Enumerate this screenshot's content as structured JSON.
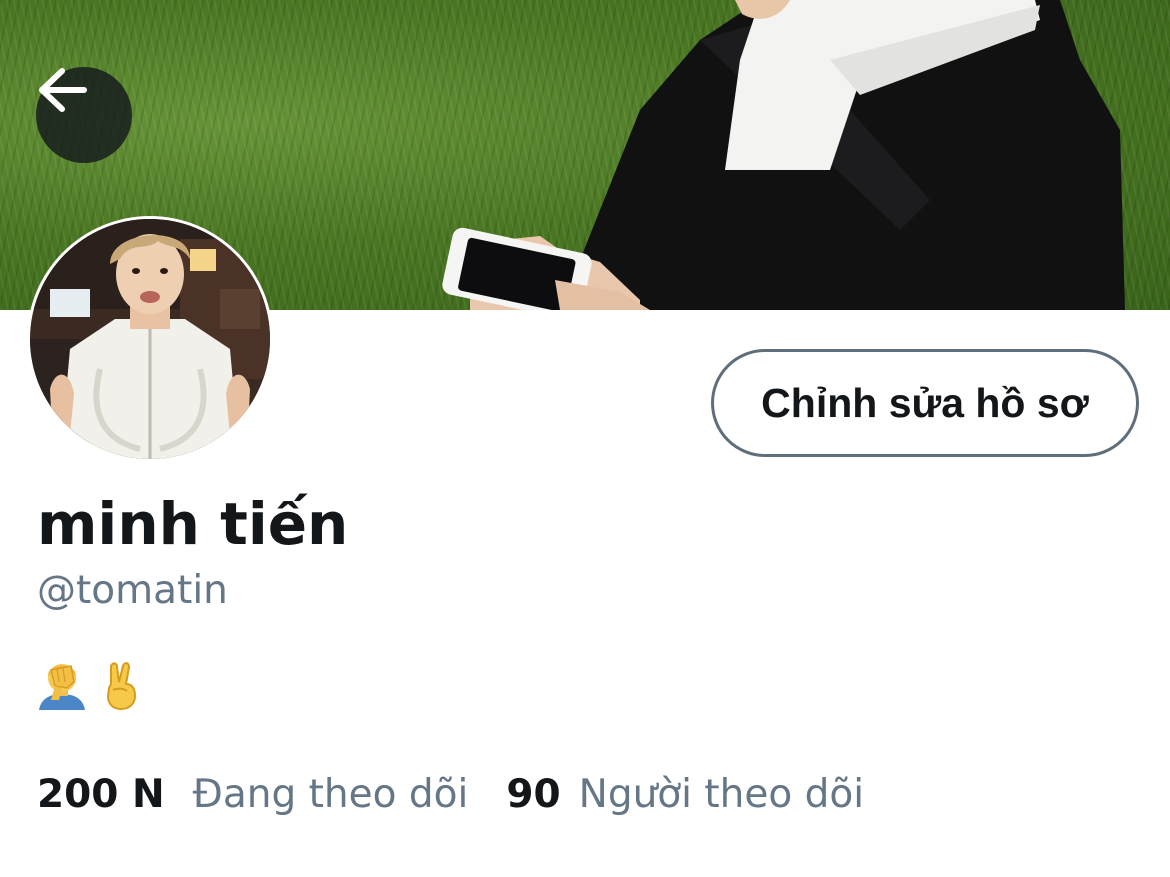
{
  "header": {
    "back_icon": "arrow-left-icon",
    "banner_image": "person-in-black-jacket-on-grass-holding-phone"
  },
  "profile": {
    "avatar_image": "young-man-in-white-jacket-selfie",
    "display_name": "minh tiến",
    "handle": "@tomatin",
    "bio_emojis": [
      "person-facepalming-emoji",
      "victory-hand-emoji"
    ],
    "edit_button_label": "Chỉnh sửa hồ sơ"
  },
  "stats": {
    "following_count": "200 N",
    "following_label": "Đang theo dõi",
    "followers_count": "90",
    "followers_label": "Người theo dõi"
  },
  "colors": {
    "primary_text": "#14171a",
    "secondary_text": "#657786",
    "button_border": "#5f6e7b"
  }
}
